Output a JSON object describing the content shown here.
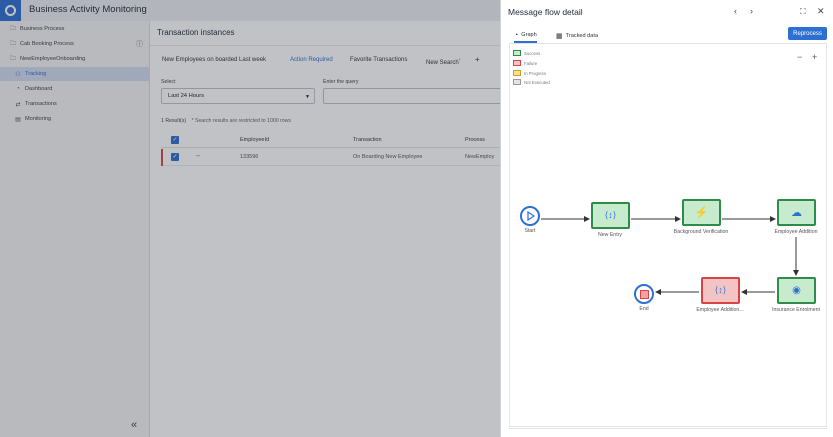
{
  "app": {
    "title": "Business Activity Monitoring"
  },
  "sidebar": {
    "items": [
      {
        "label": "Business Process",
        "icon": "folder-icon"
      },
      {
        "label": "Cab Booking Process",
        "icon": "folder-icon",
        "badge_icon": "info-icon"
      },
      {
        "label": "NewEmployeeOnboarding",
        "icon": "folder-icon"
      },
      {
        "label": "Tracking",
        "icon": "tracking-icon"
      },
      {
        "label": "Dashboard",
        "icon": "dashboard-icon"
      },
      {
        "label": "Transactions",
        "icon": "transactions-icon"
      },
      {
        "label": "Monitoring",
        "icon": "monitoring-icon"
      }
    ],
    "collapse_icon": "double-chevron-left-icon"
  },
  "main": {
    "title": "Transaction instances",
    "tabs": [
      {
        "label": "New Employees on boarded Last week"
      },
      {
        "label": "Action Required"
      },
      {
        "label": "Favorite Transactions"
      },
      {
        "label": "New Search"
      }
    ],
    "add_tab_icon": "plus-icon",
    "select_label": "Select",
    "select_value": "Last 24 Hours",
    "query_label": "Enter the query",
    "results_count": "1 Result(s)",
    "results_note": "* Search results are restricted to 1000 rows",
    "columns": [
      "EmployeeId",
      "Transaction",
      "Process"
    ],
    "rows": [
      {
        "employee_id": "133596",
        "transaction": "On Boarding New Employee",
        "process": "NewEmploy"
      }
    ]
  },
  "panel": {
    "title": "Message flow detail",
    "tabs": [
      {
        "label": "Graph",
        "icon": "graph-icon"
      },
      {
        "label": "Tracked data",
        "icon": "table-icon"
      }
    ],
    "reprocess_label": "Reprocess",
    "legend": [
      {
        "label": "Success",
        "color": "#c6eccd"
      },
      {
        "label": "Failure",
        "color": "#f4c4c4"
      },
      {
        "label": "In Progress",
        "color": "#f7e29a"
      },
      {
        "label": "Not Executed",
        "color": "#e3e3e3"
      }
    ],
    "nodes": [
      {
        "label": "Start",
        "status": "start"
      },
      {
        "label": "New Entry",
        "status": "success",
        "icon": "mapper-icon"
      },
      {
        "label": "Background Verification",
        "status": "success",
        "icon": "function-icon"
      },
      {
        "label": "Employee Addition",
        "status": "success",
        "icon": "cloud-icon"
      },
      {
        "label": "Insurance Enrolment",
        "status": "success",
        "icon": "eye-icon"
      },
      {
        "label": "Employee Addition...",
        "status": "failure",
        "icon": "mapper-icon"
      },
      {
        "label": "End",
        "status": "end"
      }
    ]
  }
}
